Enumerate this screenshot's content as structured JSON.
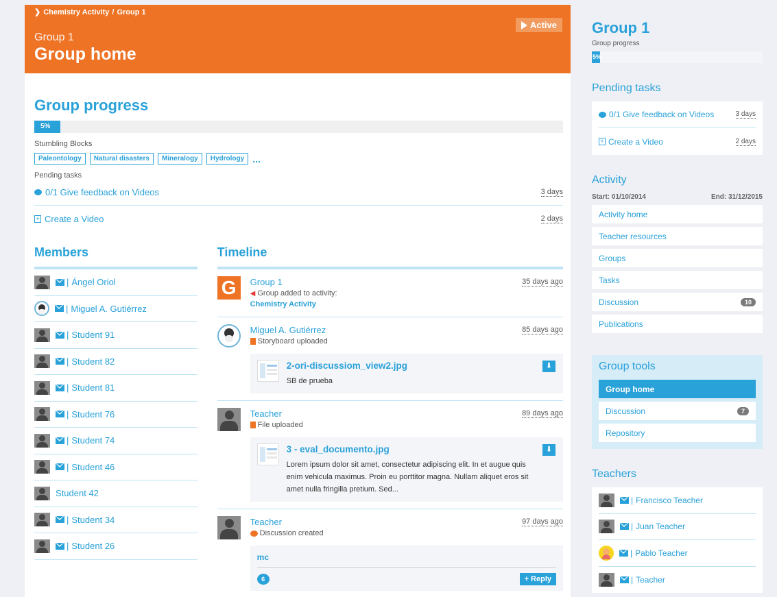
{
  "header": {
    "breadcrumb": [
      {
        "label": "Chemistry Activity"
      },
      {
        "label": "Group 1"
      }
    ],
    "breadcrumb_sep": "/",
    "subtitle": "Group 1",
    "title": "Group home",
    "status_label": "Active",
    "accent_color": "#ee7325"
  },
  "progress": {
    "title": "Group progress",
    "value_label": "5%",
    "value": 0.05
  },
  "stumbling": {
    "label": "Stumbling Blocks",
    "tags": [
      "Paleontology",
      "Natural disasters",
      "Mineralogy",
      "Hydrology"
    ],
    "more": "..."
  },
  "pending": {
    "label": "Pending tasks",
    "tasks": [
      {
        "label": "0/1 Give feedback on Videos",
        "days": "3 days",
        "icon": "speech-bubble-icon"
      },
      {
        "label": "Create a Video",
        "days": "2 days",
        "icon": "add-file-icon"
      }
    ]
  },
  "members": {
    "title": "Members",
    "list": [
      {
        "name": "Ángel Oriol",
        "avatar": "default",
        "mail": true
      },
      {
        "name": "Miguel A. Gutiérrez",
        "avatar": "penguin",
        "mail": true
      },
      {
        "name": "Student 91",
        "avatar": "default",
        "mail": true
      },
      {
        "name": "Student 82",
        "avatar": "default",
        "mail": true
      },
      {
        "name": "Student 81",
        "avatar": "default",
        "mail": true
      },
      {
        "name": "Student 76",
        "avatar": "default",
        "mail": true
      },
      {
        "name": "Student 74",
        "avatar": "default",
        "mail": true
      },
      {
        "name": "Student 46",
        "avatar": "default",
        "mail": true
      },
      {
        "name": "Student 42",
        "avatar": "default",
        "mail": false
      },
      {
        "name": "Student 34",
        "avatar": "default",
        "mail": true
      },
      {
        "name": "Student 26",
        "avatar": "default",
        "mail": true
      }
    ]
  },
  "timeline": {
    "title": "Timeline",
    "items": [
      {
        "name": "Group 1",
        "meta": "Group added to activity:",
        "link": "Chemistry Activity",
        "time": "35 days ago",
        "avatar_letter": "G"
      },
      {
        "name": "Miguel A. Gutiérrez",
        "meta": "Storyboard uploaded",
        "time": "85 days ago",
        "file_title": "2-ori-discussiom_view2.jpg",
        "file_desc": "SB de prueba"
      },
      {
        "name": "Teacher",
        "meta": "File uploaded",
        "time": "89 days ago",
        "file_title": "3 - eval_documento.jpg",
        "file_desc": "Lorem ipsum dolor sit amet, consectetur adipiscing elit. In et augue quis enim vehicula maximus. Proin eu porttitor magna. Nullam aliquet eros sit amet nulla fringilla pretium. Sed..."
      },
      {
        "name": "Teacher",
        "meta": "Discussion created",
        "time": "97 days ago",
        "disc_title": "mc",
        "disc_count": "6",
        "reply_label": "+ Reply"
      }
    ]
  },
  "sidebar": {
    "group_title": "Group 1",
    "progress_label": "Group progress",
    "progress_value_label": "5%",
    "pending_title": "Pending tasks",
    "pending_tasks": [
      {
        "label": "0/1 Give feedback on Videos",
        "days": "3 days"
      },
      {
        "label": "Create a Video",
        "days": "2 days"
      }
    ],
    "activity_title": "Activity",
    "start": "Start: 01/10/2014",
    "end": "End: 31/12/2015",
    "activity_nav": [
      {
        "label": "Activity home"
      },
      {
        "label": "Teacher resources"
      },
      {
        "label": "Groups"
      },
      {
        "label": "Tasks"
      },
      {
        "label": "Discussion",
        "count": "10"
      },
      {
        "label": "Publications"
      }
    ],
    "tools_title": "Group tools",
    "tools_nav": [
      {
        "label": "Group home",
        "selected": true
      },
      {
        "label": "Discussion",
        "count": "7"
      },
      {
        "label": "Repository"
      }
    ],
    "teachers_title": "Teachers",
    "teachers": [
      {
        "name": "Francisco Teacher",
        "avatar": "default"
      },
      {
        "name": "Juan Teacher",
        "avatar": "default"
      },
      {
        "name": "Pablo Teacher",
        "avatar": "emoji"
      },
      {
        "name": "Teacher",
        "avatar": "default"
      }
    ]
  }
}
